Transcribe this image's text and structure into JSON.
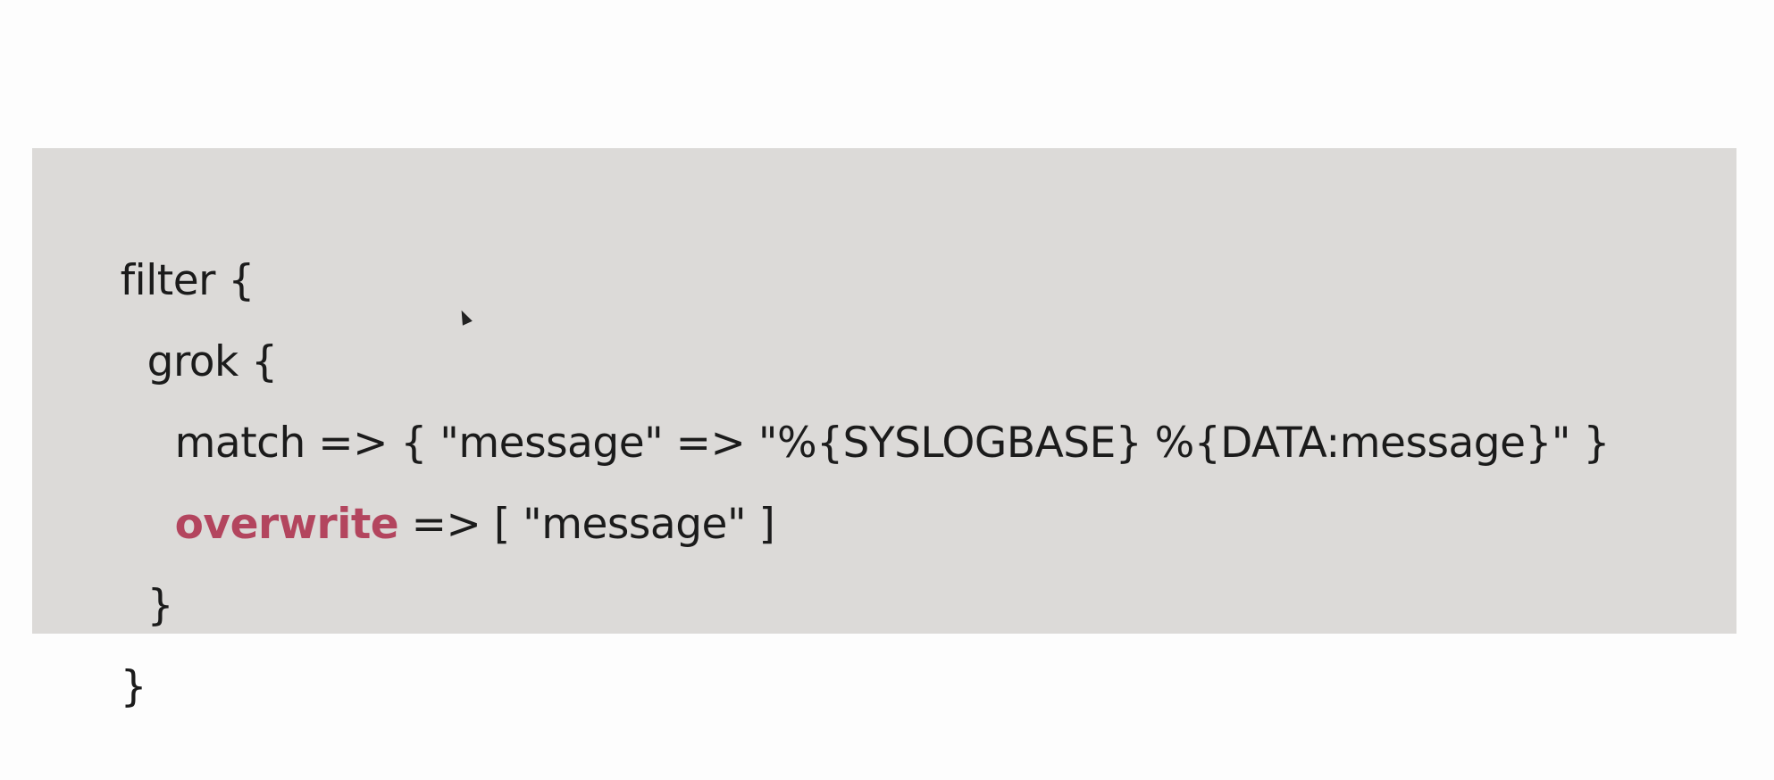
{
  "code": {
    "line1": "filter {",
    "line2": "grok {",
    "line3": "match => { \"message\" => \"%{SYSLOGBASE} %{DATA:message}\" }",
    "line4_keyword": "overwrite",
    "line4_rest": " => [ \"message\" ]",
    "line5": "}",
    "line6": "}"
  },
  "colors": {
    "background": "#fdfdfd",
    "code_background": "#dcdad8",
    "text": "#1b1b1b",
    "keyword_highlight": "#b3455e"
  },
  "icons": {
    "pointer": "mouse-pointer-icon"
  }
}
